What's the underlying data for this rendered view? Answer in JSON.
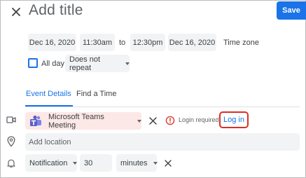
{
  "header": {
    "title_placeholder": "Add title",
    "save_label": "Save",
    "close_icon": "close-icon"
  },
  "datetime": {
    "start_date": "Dec 16, 2020",
    "start_time": "11:30am",
    "to_label": "to",
    "end_time": "12:30pm",
    "end_date": "Dec 16, 2020",
    "timezone_label": "Time zone"
  },
  "allday": {
    "label": "All day",
    "checked": false,
    "repeat_value": "Does not repeat"
  },
  "tabs": [
    {
      "label": "Event Details",
      "active": true
    },
    {
      "label": "Find a Time",
      "active": false
    }
  ],
  "conference": {
    "label": "Microsoft Teams Meeting",
    "login_required": "Login required",
    "login_button": "Log in"
  },
  "location": {
    "placeholder": "Add location"
  },
  "notification": {
    "type": "Notification",
    "amount": "30",
    "unit": "minutes"
  },
  "colors": {
    "accent": "#1a73e8",
    "alert": "#d93025",
    "teams_chip_bg": "#fce8e6",
    "teams_brand": "#5b5fc7"
  }
}
